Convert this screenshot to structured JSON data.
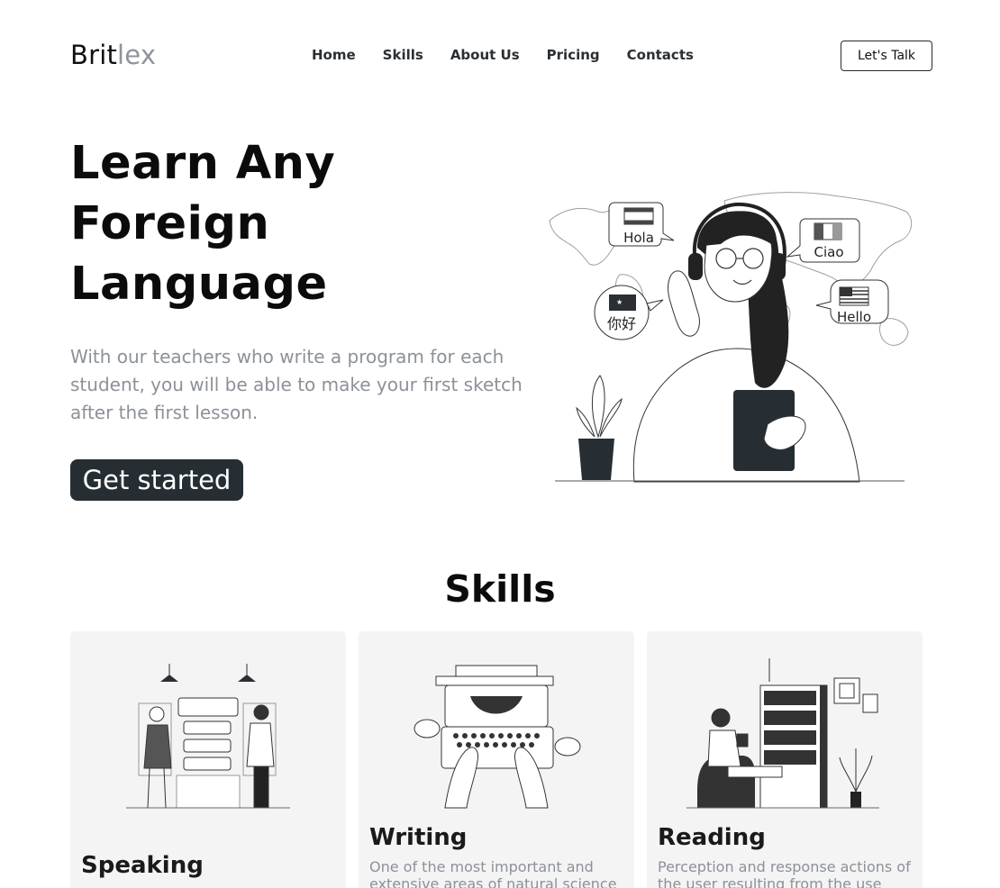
{
  "header": {
    "logo_part1": "Brit",
    "logo_part2": "lex",
    "nav": [
      "Home",
      "Skills",
      "About Us",
      "Pricing",
      "Contacts"
    ],
    "cta_label": "Let's Talk"
  },
  "hero": {
    "title_line1": "Learn Any",
    "title_line2": "Foreign",
    "title_line3": "Language",
    "description": "With our teachers who write a program for each student, you will be able to make your first sketch after the first lesson.",
    "button_label": "Get started",
    "bubbles": {
      "spanish": "Hola",
      "italian": "Ciao",
      "chinese": "你好",
      "english": "Hello"
    }
  },
  "skills": {
    "title": "Skills",
    "cards": [
      {
        "title": "Speaking",
        "text": ""
      },
      {
        "title": "Writing",
        "text": "One of the most important and extensive areas of natural science"
      },
      {
        "title": "Reading",
        "text": "Perception and response actions of the user resulting from the use"
      }
    ]
  },
  "colors": {
    "dark": "#262e33",
    "muted_text": "#8c9199",
    "card_bg": "#f4f4f4"
  }
}
